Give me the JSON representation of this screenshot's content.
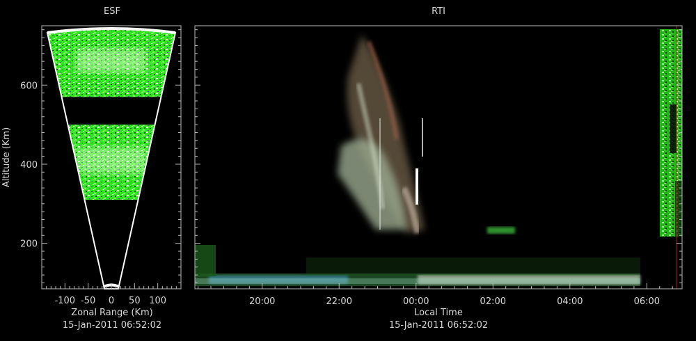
{
  "chart_data": [
    {
      "type": "heatmap",
      "title": "ESF",
      "xlabel": "Zonal Range (Km)",
      "ylabel": "Altitude (Km)",
      "timestamp": "15-Jan-2011 06:52:02",
      "xlim": [
        -150,
        150
      ],
      "ylim": [
        85,
        750
      ],
      "xticks": [
        -100,
        -50,
        0,
        50,
        100
      ],
      "yticks": [
        200,
        400,
        600
      ],
      "echo_bands": [
        {
          "alt_min": 570,
          "alt_max": 745,
          "intensity": "strong"
        },
        {
          "alt_min": 310,
          "alt_max": 500,
          "intensity": "strong"
        }
      ]
    },
    {
      "type": "heatmap",
      "title": "RTI",
      "xlabel": "Local Time",
      "timestamp": "15-Jan-2011 06:52:02",
      "xlim": [
        "18:15",
        "06:55"
      ],
      "ylim": [
        85,
        750
      ],
      "xticks": [
        "20:00",
        "22:00",
        "00:00",
        "02:00",
        "04:00",
        "06:00"
      ],
      "yticks": [
        200,
        400,
        600
      ],
      "features": [
        {
          "name": "plume",
          "time_start": "22:00",
          "time_end": "00:45",
          "alt_min": 250,
          "alt_max": 745
        },
        {
          "name": "bottomside layer",
          "time_start": "18:15",
          "time_end": "05:50",
          "alt_min": 85,
          "alt_max": 120
        },
        {
          "name": "echo at 02:30",
          "time_start": "02:10",
          "time_end": "02:55",
          "alt_min": 225,
          "alt_max": 240
        },
        {
          "name": "current scan",
          "time_start": "06:40",
          "time_end": "06:55",
          "alt_min": 180,
          "alt_max": 745
        }
      ]
    }
  ]
}
